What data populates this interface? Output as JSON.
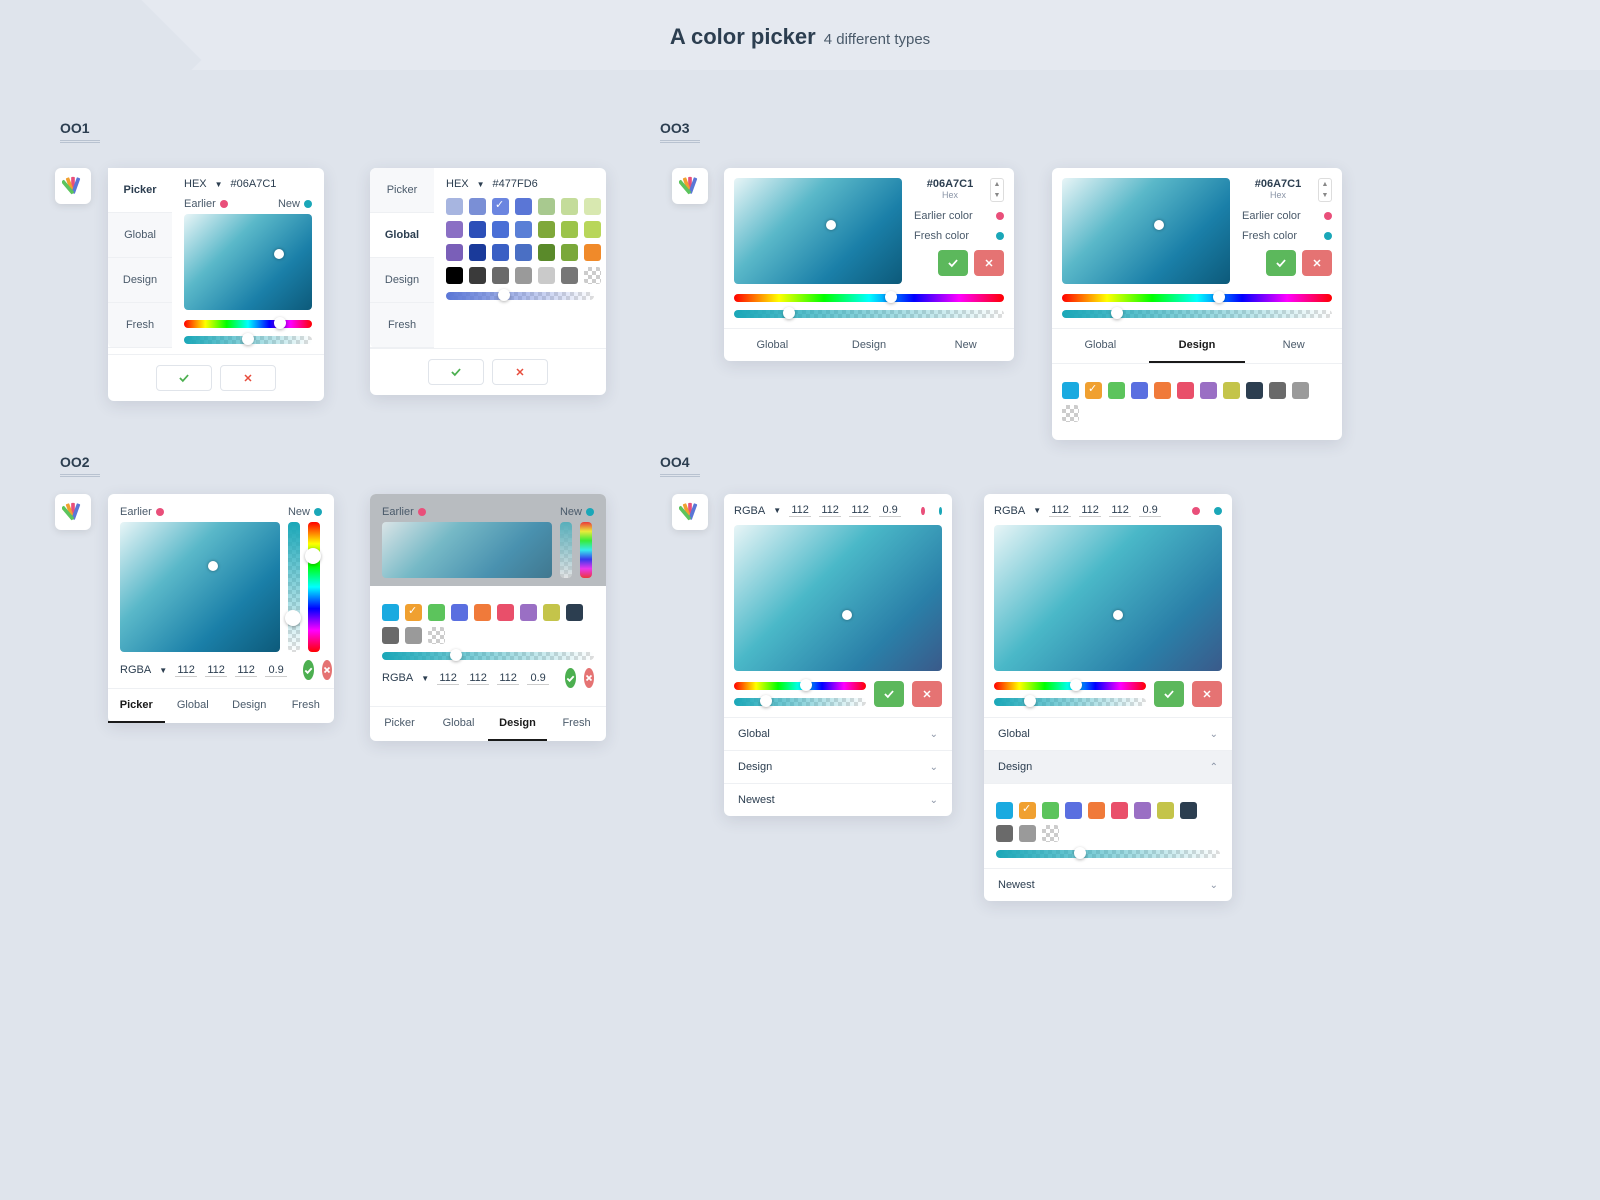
{
  "header": {
    "title": "A color picker",
    "subtitle": "4 different types"
  },
  "sections": {
    "s1": "OO1",
    "s2": "OO2",
    "s3": "OO3",
    "s4": "OO4"
  },
  "tabs": {
    "picker": "Picker",
    "global": "Global",
    "design": "Design",
    "fresh": "Fresh",
    "newest": "Newest",
    "new": "New"
  },
  "labels": {
    "earlier": "Earlier",
    "new": "New",
    "earlier_color": "Earlier color",
    "fresh_color": "Fresh color",
    "hex": "Hex"
  },
  "format": {
    "hex": "HEX",
    "rgba": "RGBA"
  },
  "values": {
    "hex1": "#06A7C1",
    "hex2": "#477FD6",
    "rgba_r": "112",
    "rgba_g": "112",
    "rgba_b": "112",
    "rgba_a": "0.9"
  },
  "palette_global": [
    "#a7b5e0",
    "#7a8fd6",
    "#6b85e0",
    "#5a76d6",
    "#a8c98f",
    "#c4dc9a",
    "#d8e8b0",
    "#8a6fc4",
    "#2c4fb8",
    "#4a6fd6",
    "#5a7fd6",
    "#7fa83a",
    "#9cc44a",
    "#b8d65a",
    "#7a5fb8",
    "#1a3a9a",
    "#3a5fc4",
    "#4a6fc4",
    "#5a8a2a",
    "#7aa83a",
    "#f08a2a",
    "#000000",
    "#3a3a3a",
    "#6a6a6a",
    "#9a9a9a",
    "#cacaca",
    "#777777"
  ],
  "palette_design": [
    "#1aaae0",
    "#f0a030",
    "#5cc45c",
    "#5a6fe0",
    "#f07a3a",
    "#e94f6a",
    "#9a6fc4",
    "#c4c44a",
    "#2c3e50",
    "#6a6a6a",
    "#9a9a9a"
  ],
  "colors": {
    "pink": "#e94f7a",
    "teal": "#1aa7b8"
  }
}
